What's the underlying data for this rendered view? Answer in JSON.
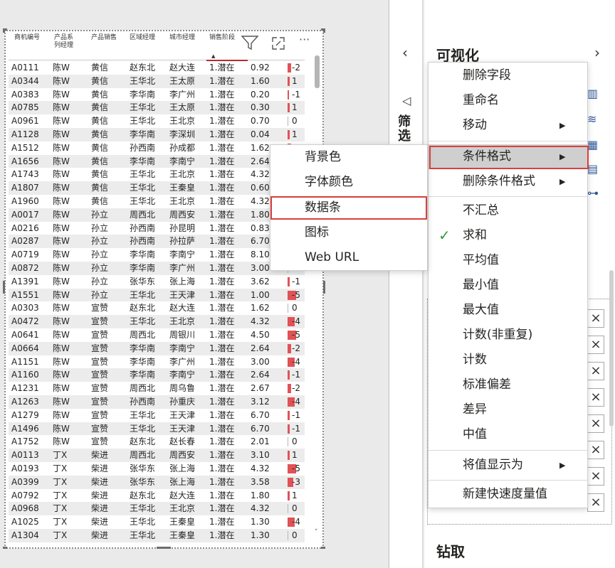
{
  "table": {
    "headers": [
      [
        "商机编号"
      ],
      [
        "产品系",
        "列经理"
      ],
      [
        "产品销售"
      ],
      [
        "区域经理"
      ],
      [
        "城市经理"
      ],
      [
        "销售阶段"
      ]
    ],
    "rows": [
      [
        "A0111",
        "陈W",
        "黄信",
        "赵东北",
        "赵大连",
        "1.潜在",
        "0.92",
        "-2"
      ],
      [
        "A0344",
        "陈W",
        "黄信",
        "王华北",
        "王太原",
        "1.潜在",
        "1.60",
        "1"
      ],
      [
        "A0383",
        "陈W",
        "黄信",
        "李华南",
        "李广州",
        "1.潜在",
        "0.20",
        "-1"
      ],
      [
        "A0785",
        "陈W",
        "黄信",
        "王华北",
        "王太原",
        "1.潜在",
        "0.30",
        "1"
      ],
      [
        "A0961",
        "陈W",
        "黄信",
        "王华北",
        "王北京",
        "1.潜在",
        "0.70",
        "0"
      ],
      [
        "A1128",
        "陈W",
        "黄信",
        "李华南",
        "李深圳",
        "1.潜在",
        "0.04",
        "1"
      ],
      [
        "A1512",
        "陈W",
        "黄信",
        "孙西南",
        "孙成都",
        "1.潜在",
        "1.62",
        ""
      ],
      [
        "A1656",
        "陈W",
        "黄信",
        "李华南",
        "李南宁",
        "1.潜在",
        "2.64",
        ""
      ],
      [
        "A1743",
        "陈W",
        "黄信",
        "王华北",
        "王北京",
        "1.潜在",
        "4.32",
        ""
      ],
      [
        "A1807",
        "陈W",
        "黄信",
        "王华北",
        "王秦皇",
        "1.潜在",
        "0.60",
        ""
      ],
      [
        "A1960",
        "陈W",
        "黄信",
        "王华北",
        "王北京",
        "1.潜在",
        "4.32",
        ""
      ],
      [
        "A0017",
        "陈W",
        "孙立",
        "周西北",
        "周西安",
        "1.潜在",
        "1.80",
        ""
      ],
      [
        "A0216",
        "陈W",
        "孙立",
        "孙西南",
        "孙昆明",
        "1.潜在",
        "0.83",
        ""
      ],
      [
        "A0287",
        "陈W",
        "孙立",
        "孙西南",
        "孙拉萨",
        "1.潜在",
        "6.70",
        ""
      ],
      [
        "A0719",
        "陈W",
        "孙立",
        "李华南",
        "李南宁",
        "1.潜在",
        "8.10",
        ""
      ],
      [
        "A0872",
        "陈W",
        "孙立",
        "李华南",
        "李广州",
        "1.潜在",
        "3.00",
        ""
      ],
      [
        "A1391",
        "陈W",
        "孙立",
        "张华东",
        "张上海",
        "1.潜在",
        "3.62",
        "-1"
      ],
      [
        "A1551",
        "陈W",
        "孙立",
        "王华北",
        "王天津",
        "1.潜在",
        "1.00",
        "-5"
      ],
      [
        "A0303",
        "陈W",
        "宣赞",
        "赵东北",
        "赵大连",
        "1.潜在",
        "1.62",
        "0"
      ],
      [
        "A0472",
        "陈W",
        "宣赞",
        "王华北",
        "王北京",
        "1.潜在",
        "4.32",
        "-4"
      ],
      [
        "A0641",
        "陈W",
        "宣赞",
        "周西北",
        "周银川",
        "1.潜在",
        "4.50",
        "-5"
      ],
      [
        "A0664",
        "陈W",
        "宣赞",
        "李华南",
        "李南宁",
        "1.潜在",
        "2.64",
        "-2"
      ],
      [
        "A1151",
        "陈W",
        "宣赞",
        "李华南",
        "李广州",
        "1.潜在",
        "3.00",
        "-4"
      ],
      [
        "A1160",
        "陈W",
        "宣赞",
        "李华南",
        "李南宁",
        "1.潜在",
        "2.64",
        "-1"
      ],
      [
        "A1231",
        "陈W",
        "宣赞",
        "周西北",
        "周乌鲁",
        "1.潜在",
        "2.67",
        "-2"
      ],
      [
        "A1263",
        "陈W",
        "宣赞",
        "孙西南",
        "孙重庆",
        "1.潜在",
        "3.12",
        "-4"
      ],
      [
        "A1279",
        "陈W",
        "宣赞",
        "王华北",
        "王天津",
        "1.潜在",
        "6.70",
        "-1"
      ],
      [
        "A1496",
        "陈W",
        "宣赞",
        "王华北",
        "王天津",
        "1.潜在",
        "6.70",
        "-1"
      ],
      [
        "A1752",
        "陈W",
        "宣赞",
        "赵东北",
        "赵长春",
        "1.潜在",
        "2.01",
        "0"
      ],
      [
        "A0113",
        "丁X",
        "柴进",
        "周西北",
        "周西安",
        "1.潜在",
        "3.10",
        "1"
      ],
      [
        "A0193",
        "丁X",
        "柴进",
        "张华东",
        "张上海",
        "1.潜在",
        "4.32",
        "-5"
      ],
      [
        "A0399",
        "丁X",
        "柴进",
        "张华东",
        "张上海",
        "1.潜在",
        "3.58",
        "-3"
      ],
      [
        "A0792",
        "丁X",
        "柴进",
        "赵东北",
        "赵大连",
        "1.潜在",
        "1.80",
        "1"
      ],
      [
        "A0968",
        "丁X",
        "柴进",
        "王华北",
        "王北京",
        "1.潜在",
        "4.32",
        "0"
      ],
      [
        "A1025",
        "丁X",
        "柴进",
        "王华北",
        "王秦皇",
        "1.潜在",
        "1.30",
        "-4"
      ],
      [
        "A1304",
        "丁X",
        "柴进",
        "王华北",
        "王秦皇",
        "1.潜在",
        "1.30",
        "0"
      ]
    ],
    "bar_fraction": [
      0.35,
      0.18,
      0.15,
      0.18,
      0.0,
      0.18,
      0.35,
      0,
      0,
      0,
      0,
      0,
      0,
      0,
      0,
      0,
      0.18,
      0.85,
      0.0,
      0.7,
      0.85,
      0.35,
      0.7,
      0.18,
      0.35,
      0.7,
      0.18,
      0.18,
      0.0,
      0.18,
      0.85,
      0.55,
      0.18,
      0.0,
      0.7,
      0.0
    ]
  },
  "filters_pane": {
    "label": "筛选"
  },
  "viz_pane": {
    "title": "可视化",
    "drill_label": "钻取"
  },
  "main_menu": {
    "items": [
      {
        "label": "删除字段"
      },
      {
        "label": "重命名"
      },
      {
        "label": "移动"
      },
      {
        "label": "条件格式"
      },
      {
        "label": "删除条件格式"
      },
      {
        "label": "不汇总"
      },
      {
        "label": "求和"
      },
      {
        "label": "平均值"
      },
      {
        "label": "最小值"
      },
      {
        "label": "最大值"
      },
      {
        "label": "计数(非重复)"
      },
      {
        "label": "计数"
      },
      {
        "label": "标准偏差"
      },
      {
        "label": "差异"
      },
      {
        "label": "中值"
      },
      {
        "label": "将值显示为"
      },
      {
        "label": "新建快速度量值"
      }
    ]
  },
  "sub_menu": {
    "items": [
      {
        "label": "背景色"
      },
      {
        "label": "字体颜色"
      },
      {
        "label": "数据条"
      },
      {
        "label": "图标"
      },
      {
        "label": "Web URL"
      }
    ]
  },
  "colors": {
    "bar": "#e05256",
    "highlight_box": "#d9403a",
    "check": "#2f9c3a"
  }
}
